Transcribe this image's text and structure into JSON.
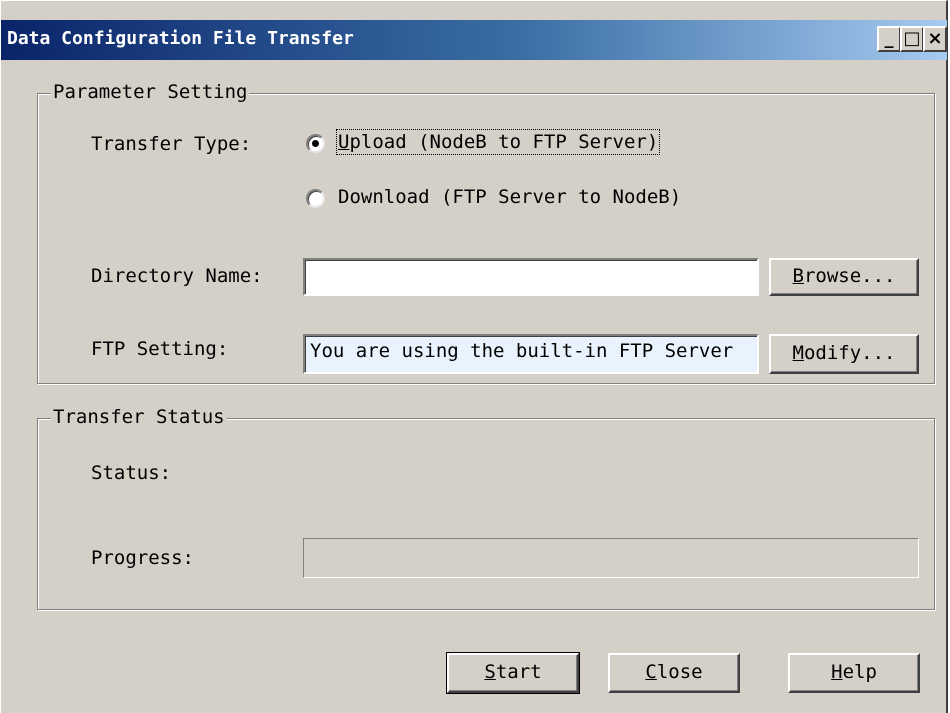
{
  "window": {
    "title": "Data Configuration File Transfer",
    "buttons": {
      "minimize": "_",
      "maximize": "□",
      "close": "×"
    }
  },
  "parameter_setting": {
    "legend": "Parameter Setting",
    "transfer_type_label": "Transfer Type:",
    "upload_prefix": "U",
    "upload_rest": "pload (NodeB to FTP Server)",
    "download_label": "Download (FTP Server to NodeB)",
    "upload_selected": true,
    "directory_label": "Directory Name:",
    "directory_value": "",
    "browse_mnemonic": "B",
    "browse_rest": "rowse...",
    "ftp_label": "FTP Setting:",
    "ftp_value": "You are using the built-in FTP Server",
    "modify_mnemonic": "M",
    "modify_rest": "odify..."
  },
  "transfer_status": {
    "legend": "Transfer Status",
    "status_label": "Status:",
    "status_value": "",
    "progress_label": "Progress:",
    "progress_fraction": 0
  },
  "footer": {
    "start_mnemonic": "S",
    "start_rest": "tart",
    "close_mnemonic": "C",
    "close_rest": "lose",
    "help_mnemonic": "H",
    "help_rest": "elp"
  }
}
